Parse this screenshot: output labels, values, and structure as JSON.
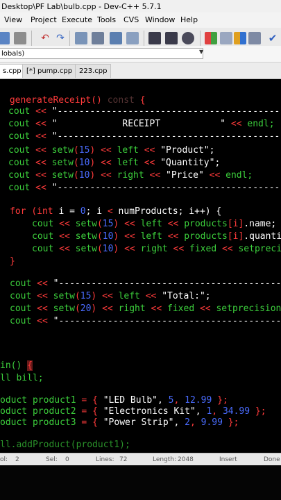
{
  "window": {
    "title": "Desktop\\PF Lab\\bulb.cpp - Dev-C++ 5.7.1"
  },
  "menu": [
    "View",
    "Project",
    "Execute",
    "Tools",
    "CVS",
    "Window",
    "Help"
  ],
  "scope": {
    "value": "lobals)"
  },
  "tabs": [
    {
      "label": "s.cpp",
      "active": true
    },
    {
      "label": "[*] pump.cpp",
      "active": false
    },
    {
      "label": "223.cpp",
      "active": false
    }
  ],
  "code": {
    "l1_fn": "generateReceipt",
    "l1_rest": "()",
    "l1_const": "const",
    "l1_brace": "{",
    "cout": "cout",
    "shl": "<<",
    "dash": "\"-----------------------------------------\"",
    "dash_end": "\"",
    "receipt": "\"            RECEIPT           \"",
    "endl": "endl;",
    "setw": "setw",
    "n15": "15",
    "n10": "10",
    "n20": "20",
    "left": "left",
    "right": "right",
    "product": "\"Product\";",
    "quantity": "\"Quantity\";",
    "price": "\"Price\"",
    "for_kw": "for",
    "int_kw": "int",
    "for_body": "i = ",
    "zero": "0",
    "for_cond": "; i ",
    "lt": "<",
    "for_tail": " numProducts; i++) {",
    "products": "products",
    "idx": "[i]",
    "name": ".name;",
    "quantit": ".quantit",
    "fixed": "fixed",
    "setprecis": "setprecis",
    "setprecision": "setprecision(",
    "close": "}",
    "total": "\"Total:\";",
    "main": "in()",
    "main_brace": "{",
    "bill": "ll bill;",
    "odp": "oduct",
    "p1": "product1",
    "p2": "product2",
    "p3": "product3",
    "eq": "= {",
    "led": "\"LED Bulb\",",
    "elec": "\"Electronics Kit\",",
    "power": "\"Power Strip\",",
    "q5": "5",
    "q1": "1",
    "q2": "2",
    "pr1": "12.99",
    "pr2": "34.99",
    "pr3": "9.99",
    "end_brace": "};",
    "last": "ll.addProduct(product1);"
  },
  "status": {
    "col_label": "ol:",
    "col": "2",
    "sel_label": "Sel:",
    "sel": "0",
    "lines_label": "Lines:",
    "lines": "72",
    "length_label": "Length:",
    "length": "2048",
    "mode": "Insert",
    "state": "Done"
  },
  "colors": {
    "keyword": "#3ccf3c",
    "operator": "#ff3b3b",
    "number": "#4a6cff",
    "string": "#ffffff",
    "background": "#000000"
  }
}
